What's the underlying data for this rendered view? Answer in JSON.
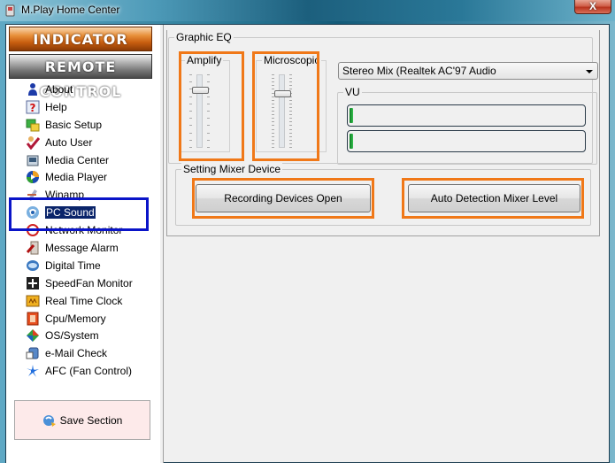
{
  "window": {
    "title": "M.Play Home Center",
    "close_label": "X"
  },
  "sidebar": {
    "headers": [
      {
        "label": "INDICATOR"
      },
      {
        "label": "REMOTE CONTROL"
      }
    ],
    "items": [
      {
        "label": "About",
        "icon": "person-icon"
      },
      {
        "label": "Help",
        "icon": "help-icon"
      },
      {
        "label": "Basic Setup",
        "icon": "setup-icon"
      },
      {
        "label": "Auto User",
        "icon": "auto-user-icon"
      },
      {
        "label": "Media Center",
        "icon": "media-center-icon"
      },
      {
        "label": "Media Player",
        "icon": "media-player-icon"
      },
      {
        "label": "Winamp",
        "icon": "winamp-icon"
      },
      {
        "label": "PC Sound",
        "icon": "pc-sound-icon",
        "selected": true
      },
      {
        "label": "Network Monitor",
        "icon": "network-icon"
      },
      {
        "label": "Message Alarm",
        "icon": "message-alarm-icon"
      },
      {
        "label": "Digital Time",
        "icon": "digital-time-icon"
      },
      {
        "label": "SpeedFan Monitor",
        "icon": "speedfan-icon"
      },
      {
        "label": "Real Time Clock",
        "icon": "clock-icon"
      },
      {
        "label": "Cpu/Memory",
        "icon": "cpu-icon"
      },
      {
        "label": "OS/System",
        "icon": "os-icon"
      },
      {
        "label": "e-Mail Check",
        "icon": "email-icon"
      },
      {
        "label": "AFC (Fan Control)",
        "icon": "fan-icon"
      }
    ],
    "save_label": "Save Section"
  },
  "main": {
    "graphic_eq": {
      "title": "Graphic EQ",
      "sliders": [
        {
          "label": "Amplify",
          "value_fraction": 0.82
        },
        {
          "label": "Microscopic",
          "value_fraction": 0.76
        }
      ]
    },
    "device_select": {
      "value": "Stereo Mix (Realtek AC'97 Audio"
    },
    "vu": {
      "title": "VU",
      "levels": [
        0.01,
        0.01
      ]
    },
    "mixer": {
      "title": "Setting Mixer Device",
      "recording_button": "Recording Devices Open",
      "auto_detect_button": "Auto Detection Mixer Level"
    }
  },
  "colors": {
    "annotation_orange": "#f07818",
    "annotation_blue": "#0a14c8",
    "selection": "#0a246a"
  }
}
